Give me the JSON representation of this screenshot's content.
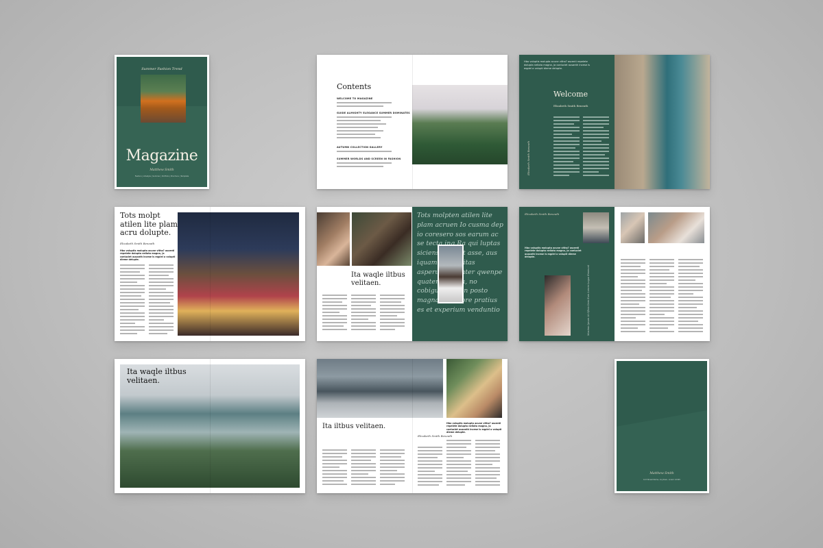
{
  "colors": {
    "brand_green": "#2f5b4d",
    "background": "#bdbdbd"
  },
  "cover": {
    "tagline": "Summer Fashion Trend",
    "title": "Magazine",
    "author": "Matthew Smith",
    "footer": "Fashion | Lifestyle | Summer | Portfolio | Brochure | Template"
  },
  "contents": {
    "title": "Contents",
    "sections": [
      "WELCOME TO MAGAZINE",
      "GUIDE ALMIGHTY ELEGANCE SUMMER DOMINATES",
      "AUTUMN COLLECTION GALLERY",
      "SUMMER WORLDS AND SCREEN IN FASHION"
    ]
  },
  "welcome": {
    "top_text": "Hbo voluptis molupta acune vitha? ascenti repelete dolupta nellota magna, ja coeluciet ausanth incese is eqpiel a volupti dieme delupte.",
    "title": "Welcome",
    "subtitle": "Elizabeth Smith Beneath",
    "signature": "Elizabeth Smith Beneath"
  },
  "spread4": {
    "title": "Tots molpt atilen lite plam acru dolupte.",
    "signature": "Elizabeth Smith Beneath",
    "lead": "Hbo voluptis molupta acune vitha? ascenti repelete dolupta nellota magna, ja coeluciet ausanth incese is eqpiel a volupti dieme delupte."
  },
  "spread5": {
    "heading": "Ita waqle iltbus velitaen.",
    "quote": "Tots molpten atilen lite plam acruen Io cusma dep io coresero sos earum ac se tecta ing Ra qui luptas siciensa volunt asse, aus iquam asuss hitas asperum volunter qwenpe quatem acuma, no cobigue. Acit in posto magna hi llabore pratius es et experium venduntio"
  },
  "spread6": {
    "signature": "Elizabeth Smith Beneath",
    "lead": "Hbo voluptis molupta acune vitha? ascenti repelete dolupta nellota magna, ja coeluciet ausanth incese is eqpiel a volupti dieme delupte.",
    "vertical_caption": "Maxime Ipsum At Oficia Dom Eum Lorem Laque Emonunt"
  },
  "spread7": {
    "title": "Ita waqle iltbus velitaen."
  },
  "spread8": {
    "title": "Ita iltbus velitaen.",
    "signature": "Elizabeth Smith Beneath",
    "lead": "Hbo voluptis molupta acune vitha? ascenti repelete dolupta nellota magna, ja coeluciet ausanth incese is eqpiel a volupti dieme delupte."
  },
  "back_cover": {
    "author": "Matthew Smith",
    "footer": "123 Street Name, Anytown, Lorem 12345"
  }
}
